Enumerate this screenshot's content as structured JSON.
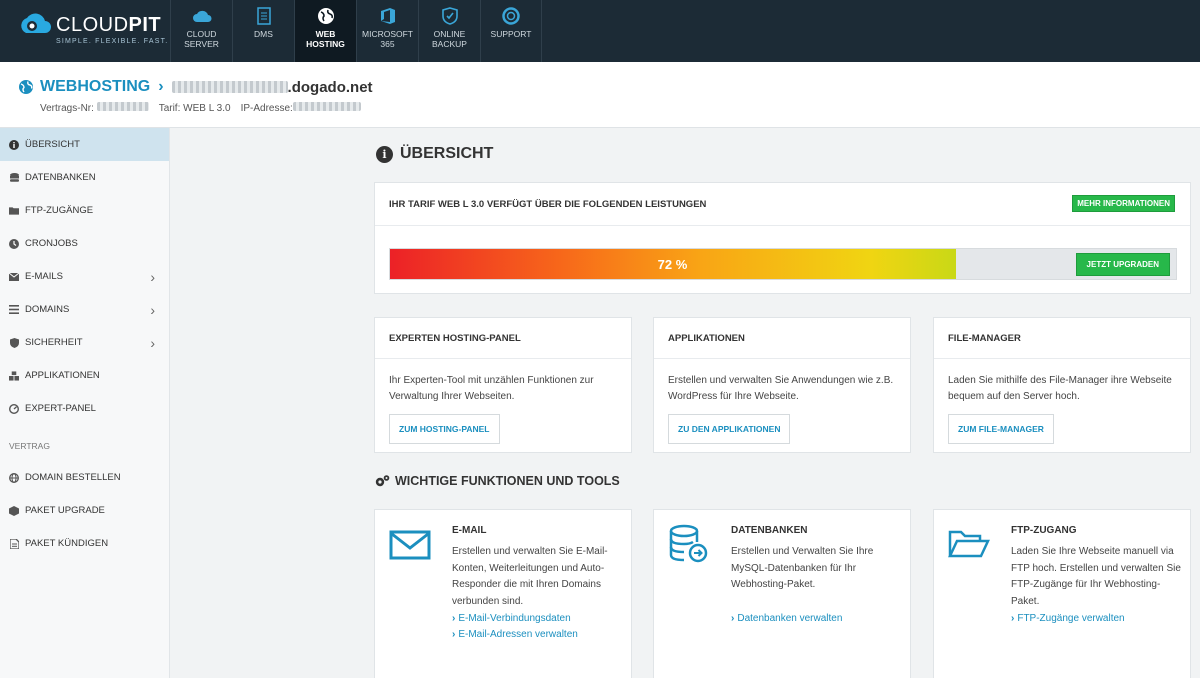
{
  "brand": {
    "name_a": "CLOUD",
    "name_b": "PIT",
    "tagline": "SIMPLE. FLEXIBLE. FAST."
  },
  "nav": [
    {
      "line1": "CLOUD",
      "line2": "SERVER",
      "icon": "cloud-icon"
    },
    {
      "line1": "DMS",
      "line2": "",
      "icon": "document-icon"
    },
    {
      "line1": "WEB",
      "line2": "HOSTING",
      "icon": "globe-icon"
    },
    {
      "line1": "MICROSOFT",
      "line2": "365",
      "icon": "office-icon"
    },
    {
      "line1": "ONLINE",
      "line2": "BACKUP",
      "icon": "shield-icon"
    },
    {
      "line1": "SUPPORT",
      "line2": "",
      "icon": "lifebuoy-icon"
    }
  ],
  "header": {
    "title": "WEBHOSTING",
    "domain_suffix": ".dogado.net",
    "contract_label": "Vertrags-Nr:",
    "tarif_label": "Tarif:",
    "tarif_value": "WEB L 3.0",
    "ip_label": "IP-Adresse:"
  },
  "sidebar": {
    "items": [
      {
        "label": "ÜBERSICHT",
        "icon": "info-icon"
      },
      {
        "label": "DATENBANKEN",
        "icon": "database-icon"
      },
      {
        "label": "FTP-ZUGÄNGE",
        "icon": "folder-icon"
      },
      {
        "label": "CRONJOBS",
        "icon": "clock-icon"
      },
      {
        "label": "E-MAILS",
        "icon": "envelope-icon"
      },
      {
        "label": "DOMAINS",
        "icon": "list-icon"
      },
      {
        "label": "SICHERHEIT",
        "icon": "shield-icon"
      },
      {
        "label": "APPLIKATIONEN",
        "icon": "cubes-icon"
      },
      {
        "label": "EXPERT-PANEL",
        "icon": "gauge-icon"
      }
    ],
    "section": "VERTRAG",
    "contract_items": [
      {
        "label": "DOMAIN BESTELLEN",
        "icon": "globe-icon"
      },
      {
        "label": "PAKET UPGRADE",
        "icon": "box-icon"
      },
      {
        "label": "PAKET KÜNDIGEN",
        "icon": "file-icon"
      }
    ]
  },
  "main": {
    "title": "ÜBERSICHT",
    "tarif_card": {
      "heading": "IHR TARIF WEB L 3.0 VERFÜGT ÜBER DIE FOLGENDEN LEISTUNGEN",
      "more_button": "MEHR INFORMATIONEN",
      "usage_percent_label": "72 %",
      "usage_fraction": 0.72,
      "upgrade_button": "JETZT UPGRADEN"
    },
    "services": [
      {
        "heading": "EXPERTEN HOSTING-PANEL",
        "text": "Ihr Experten-Tool mit unzählen Funktionen zur Verwaltung Ihrer Webseiten.",
        "button": "ZUM HOSTING-PANEL"
      },
      {
        "heading": "APPLIKATIONEN",
        "text": "Erstellen und verwalten Sie Anwendungen wie z.B. WordPress für Ihre Webseite.",
        "button": "ZU DEN APPLIKATIONEN"
      },
      {
        "heading": "FILE-MANAGER",
        "text": "Laden Sie mithilfe des File-Manager ihre Webseite bequem auf den Server hoch.",
        "button": "ZUM FILE-MANAGER"
      }
    ],
    "tools_title": "WICHTIGE FUNKTIONEN UND TOOLS",
    "tools": [
      {
        "title": "E-MAIL",
        "icon": "envelope-icon",
        "text": "Erstellen und verwalten Sie E-Mail-Konten, Weiterleitungen und Auto-Responder die mit Ihren Domains verbunden sind.",
        "links": [
          "E-Mail-Verbindungsdaten",
          "E-Mail-Adressen verwalten"
        ]
      },
      {
        "title": "DATENBANKEN",
        "icon": "database-icon",
        "text": "Erstellen und Verwalten Sie Ihre MySQL-Datenbanken für Ihr Webhosting-Paket.",
        "links": [
          "Datenbanken verwalten"
        ]
      },
      {
        "title": "FTP-ZUGANG",
        "icon": "folder-open-icon",
        "text": "Laden Sie Ihre Webseite manuell via FTP hoch. Erstellen und verwalten Sie FTP-Zugänge für Ihr Webhosting-Paket.",
        "links": [
          "FTP-Zugänge verwalten"
        ]
      }
    ]
  },
  "colors": {
    "accent": "#1b8fbf",
    "green": "#27b84a",
    "nav_bg": "#1c2b36"
  }
}
